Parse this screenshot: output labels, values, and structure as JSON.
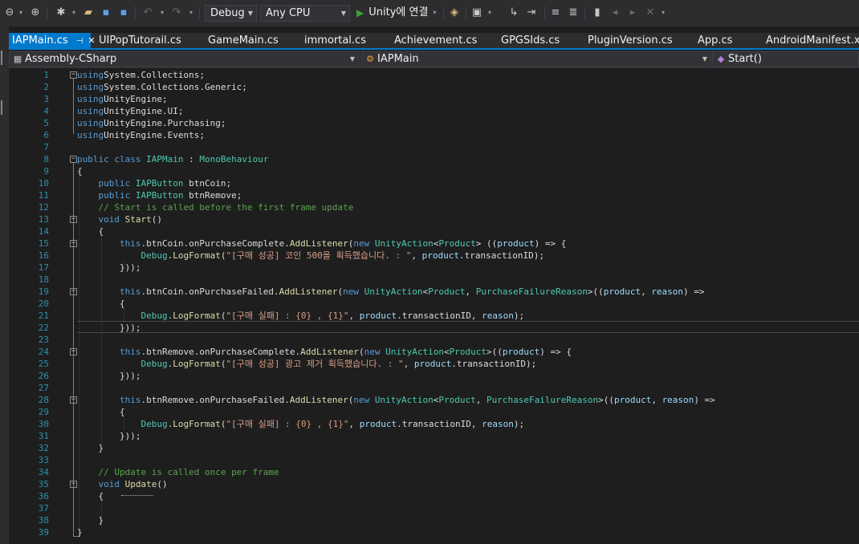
{
  "toolbar": {
    "config": "Debug",
    "platform": "Any CPU",
    "run_label": "Unity에 연결",
    "colors": {
      "run": "#3aa43a",
      "accent": "#007acc"
    }
  },
  "tabs": [
    {
      "label": "IAPMain.cs",
      "active": true
    },
    {
      "label": "UIPopTutorail.cs"
    },
    {
      "label": "GameMain.cs"
    },
    {
      "label": "immortal.cs"
    },
    {
      "label": "Achievement.cs"
    },
    {
      "label": "GPGSIds.cs"
    },
    {
      "label": "PluginVersion.cs"
    },
    {
      "label": "App.cs"
    },
    {
      "label": "AndroidManifest.xml"
    }
  ],
  "nav": {
    "project": "Assembly-CSharp",
    "class": "IAPMain",
    "member": "Start()"
  },
  "code_lines": [
    {
      "n": "1",
      "tokens": [
        [
          "kw",
          "using"
        ],
        [
          "",
          "System.Collections;"
        ]
      ]
    },
    {
      "n": "2",
      "tokens": [
        [
          "kw",
          "using"
        ],
        [
          "",
          "System.Collections.Generic;"
        ]
      ]
    },
    {
      "n": "3",
      "tokens": [
        [
          "kw",
          "using"
        ],
        [
          "",
          "UnityEngine;"
        ]
      ]
    },
    {
      "n": "4",
      "tokens": [
        [
          "kw",
          "using"
        ],
        [
          "",
          "UnityEngine.UI;"
        ]
      ]
    },
    {
      "n": "5",
      "tokens": [
        [
          "kw",
          "using"
        ],
        [
          "",
          "UnityEngine.Purchasing;"
        ]
      ]
    },
    {
      "n": "6",
      "tokens": [
        [
          "kw",
          "using"
        ],
        [
          "",
          "UnityEngine.Events;"
        ]
      ]
    },
    {
      "n": "7",
      "tokens": []
    },
    {
      "n": "8",
      "tokens": [
        [
          "kw",
          "public class"
        ],
        [
          "",
          " "
        ],
        [
          "ty",
          "IAPMain"
        ],
        [
          "",
          " : "
        ],
        [
          "ty",
          "MonoBehaviour"
        ]
      ]
    },
    {
      "n": "9",
      "tokens": [
        [
          "",
          "{"
        ]
      ]
    },
    {
      "n": "10",
      "tokens": [
        [
          "",
          "    "
        ],
        [
          "kw",
          "public"
        ],
        [
          "",
          " "
        ],
        [
          "ty",
          "IAPButton"
        ],
        [
          "",
          " btnCoin;"
        ]
      ]
    },
    {
      "n": "11",
      "tokens": [
        [
          "",
          "    "
        ],
        [
          "kw",
          "public"
        ],
        [
          "",
          " "
        ],
        [
          "ty",
          "IAPButton"
        ],
        [
          "",
          " btnRemove;"
        ]
      ]
    },
    {
      "n": "12",
      "tokens": [
        [
          "",
          "    "
        ],
        [
          "cm",
          "// Start is called before the first frame update"
        ]
      ]
    },
    {
      "n": "13",
      "tokens": [
        [
          "",
          "    "
        ],
        [
          "kw",
          "void"
        ],
        [
          "",
          " "
        ],
        [
          "fn",
          "Start"
        ],
        [
          "",
          "()"
        ]
      ]
    },
    {
      "n": "14",
      "tokens": [
        [
          "",
          "    {"
        ]
      ]
    },
    {
      "n": "15",
      "tokens": [
        [
          "",
          "        "
        ],
        [
          "kw",
          "this"
        ],
        [
          "",
          ".btnCoin.onPurchaseComplete."
        ],
        [
          "fn",
          "AddListener"
        ],
        [
          "",
          "("
        ],
        [
          "kw",
          "new"
        ],
        [
          "",
          " "
        ],
        [
          "ty",
          "UnityAction"
        ],
        [
          "",
          "<"
        ],
        [
          "ty",
          "Product"
        ],
        [
          "",
          "> (("
        ],
        [
          "pr",
          "product"
        ],
        [
          "",
          ") => {"
        ]
      ]
    },
    {
      "n": "16",
      "tokens": [
        [
          "",
          "            "
        ],
        [
          "ty",
          "Debug"
        ],
        [
          "",
          "."
        ],
        [
          "fn",
          "LogFormat"
        ],
        [
          "",
          "("
        ],
        [
          "st",
          "\"[구매 성공] 코인 500을 획득했습니다. : \""
        ],
        [
          "",
          ", "
        ],
        [
          "pr",
          "product"
        ],
        [
          "",
          ".transactionID);"
        ]
      ]
    },
    {
      "n": "17",
      "tokens": [
        [
          "",
          "        }));"
        ]
      ]
    },
    {
      "n": "18",
      "tokens": []
    },
    {
      "n": "19",
      "tokens": [
        [
          "",
          "        "
        ],
        [
          "kw",
          "this"
        ],
        [
          "",
          ".btnCoin.onPurchaseFailed."
        ],
        [
          "fn",
          "AddListener"
        ],
        [
          "",
          "("
        ],
        [
          "kw",
          "new"
        ],
        [
          "",
          " "
        ],
        [
          "ty",
          "UnityAction"
        ],
        [
          "",
          "<"
        ],
        [
          "ty",
          "Product"
        ],
        [
          "",
          ", "
        ],
        [
          "ty",
          "PurchaseFailureReason"
        ],
        [
          "",
          ">(("
        ],
        [
          "pr",
          "product"
        ],
        [
          "",
          ", "
        ],
        [
          "pr",
          "reason"
        ],
        [
          "",
          ") =>"
        ]
      ]
    },
    {
      "n": "20",
      "tokens": [
        [
          "",
          "        {"
        ]
      ]
    },
    {
      "n": "21",
      "tokens": [
        [
          "",
          "            "
        ],
        [
          "ty",
          "Debug"
        ],
        [
          "",
          "."
        ],
        [
          "fn",
          "LogFormat"
        ],
        [
          "",
          "("
        ],
        [
          "st",
          "\"[구매 실패] : {0} , {1}\""
        ],
        [
          "",
          ", "
        ],
        [
          "pr",
          "product"
        ],
        [
          "",
          ".transactionID, "
        ],
        [
          "pr",
          "reason"
        ],
        [
          "",
          ");"
        ]
      ]
    },
    {
      "n": "22",
      "tokens": [
        [
          "",
          "        }));"
        ]
      ]
    },
    {
      "n": "23",
      "tokens": []
    },
    {
      "n": "24",
      "tokens": [
        [
          "",
          "        "
        ],
        [
          "kw",
          "this"
        ],
        [
          "",
          ".btnRemove.onPurchaseComplete."
        ],
        [
          "fn",
          "AddListener"
        ],
        [
          "",
          "("
        ],
        [
          "kw",
          "new"
        ],
        [
          "",
          " "
        ],
        [
          "ty",
          "UnityAction"
        ],
        [
          "",
          "<"
        ],
        [
          "ty",
          "Product"
        ],
        [
          "",
          ">(("
        ],
        [
          "pr",
          "product"
        ],
        [
          "",
          ") => {"
        ]
      ]
    },
    {
      "n": "25",
      "tokens": [
        [
          "",
          "            "
        ],
        [
          "ty",
          "Debug"
        ],
        [
          "",
          "."
        ],
        [
          "fn",
          "LogFormat"
        ],
        [
          "",
          "("
        ],
        [
          "st",
          "\"[구매 성공] 광고 제거 획득했습니다. : \""
        ],
        [
          "",
          ", "
        ],
        [
          "pr",
          "product"
        ],
        [
          "",
          ".transactionID);"
        ]
      ]
    },
    {
      "n": "26",
      "tokens": [
        [
          "",
          "        }));"
        ]
      ]
    },
    {
      "n": "27",
      "tokens": []
    },
    {
      "n": "28",
      "tokens": [
        [
          "",
          "        "
        ],
        [
          "kw",
          "this"
        ],
        [
          "",
          ".btnRemove.onPurchaseFailed."
        ],
        [
          "fn",
          "AddListener"
        ],
        [
          "",
          "("
        ],
        [
          "kw",
          "new"
        ],
        [
          "",
          " "
        ],
        [
          "ty",
          "UnityAction"
        ],
        [
          "",
          "<"
        ],
        [
          "ty",
          "Product"
        ],
        [
          "",
          ", "
        ],
        [
          "ty",
          "PurchaseFailureReason"
        ],
        [
          "",
          ">(("
        ],
        [
          "pr",
          "product"
        ],
        [
          "",
          ", "
        ],
        [
          "pr",
          "reason"
        ],
        [
          "",
          ") =>"
        ]
      ]
    },
    {
      "n": "29",
      "tokens": [
        [
          "",
          "        {"
        ]
      ]
    },
    {
      "n": "30",
      "tokens": [
        [
          "",
          "            "
        ],
        [
          "ty",
          "Debug"
        ],
        [
          "",
          "."
        ],
        [
          "fn",
          "LogFormat"
        ],
        [
          "",
          "("
        ],
        [
          "st",
          "\"[구매 실패] : {0} , {1}\""
        ],
        [
          "",
          ", "
        ],
        [
          "pr",
          "product"
        ],
        [
          "",
          ".transactionID, "
        ],
        [
          "pr",
          "reason"
        ],
        [
          "",
          ");"
        ]
      ]
    },
    {
      "n": "31",
      "tokens": [
        [
          "",
          "        }));"
        ]
      ]
    },
    {
      "n": "32",
      "tokens": [
        [
          "",
          "    }"
        ]
      ]
    },
    {
      "n": "33",
      "tokens": []
    },
    {
      "n": "34",
      "tokens": [
        [
          "",
          "    "
        ],
        [
          "cm",
          "// Update is called once per frame"
        ]
      ]
    },
    {
      "n": "35",
      "tokens": [
        [
          "",
          "    "
        ],
        [
          "kw",
          "void"
        ],
        [
          "",
          " "
        ],
        [
          "fn",
          "Update"
        ],
        [
          "",
          "()"
        ]
      ]
    },
    {
      "n": "36",
      "tokens": [
        [
          "",
          "    {"
        ]
      ]
    },
    {
      "n": "37",
      "tokens": []
    },
    {
      "n": "38",
      "tokens": [
        [
          "",
          "    }"
        ]
      ]
    },
    {
      "n": "39",
      "tokens": [
        [
          "",
          "}"
        ]
      ]
    }
  ],
  "folds": [
    "1",
    "8",
    "13",
    "15",
    "19",
    "24",
    "28",
    "35"
  ]
}
